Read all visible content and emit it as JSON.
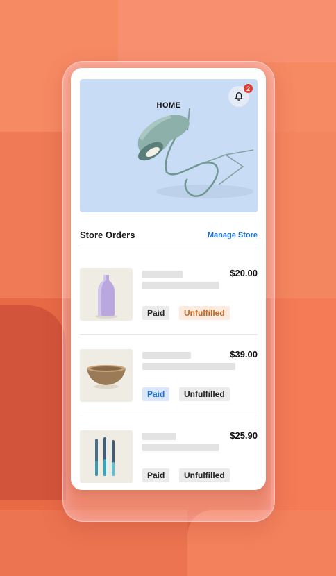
{
  "header": {
    "title": "HOME",
    "notification_count": "2",
    "notification_icon": "bell-icon"
  },
  "orders": {
    "title": "Store Orders",
    "manage_label": "Manage Store",
    "items": [
      {
        "product_icon": "vase-icon",
        "price": "$20.00",
        "payment_status": "Paid",
        "fulfillment_status": "Unfulfilled"
      },
      {
        "product_icon": "bowl-icon",
        "price": "$39.00",
        "payment_status": "Paid",
        "fulfillment_status": "Unfulfilled"
      },
      {
        "product_icon": "utensils-icon",
        "price": "$25.90",
        "payment_status": "Paid",
        "fulfillment_status": "Unfulfilled"
      }
    ]
  },
  "colors": {
    "background": "#f4865f",
    "accent_blue": "#1a6fd0",
    "unfulfilled_orange": "#c8651d",
    "badge_red": "#e23a2e"
  }
}
